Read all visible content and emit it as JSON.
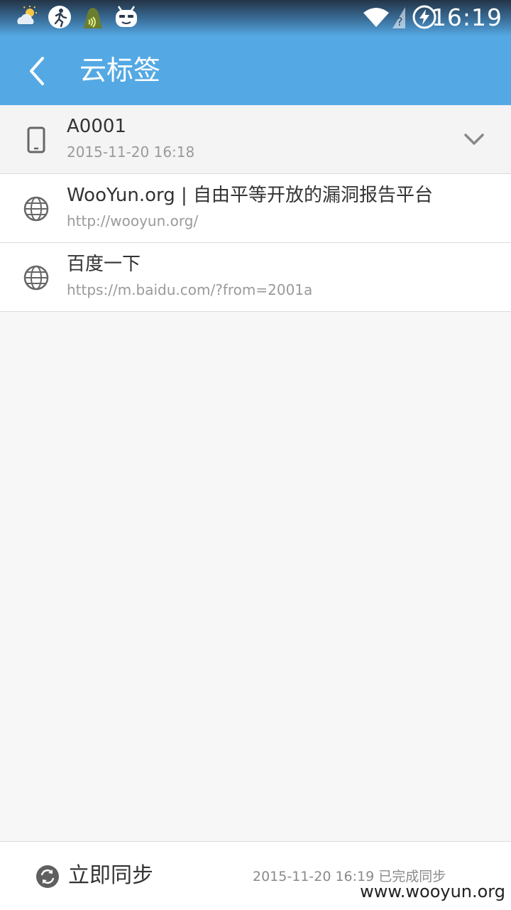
{
  "status_bar": {
    "time": "16:19",
    "left_icons": [
      "weather-icon",
      "fitness-icon",
      "notification-icon",
      "robot-icon"
    ],
    "right_icons": [
      "wifi-icon",
      "sim-unknown-icon",
      "battery-charging-icon"
    ]
  },
  "action_bar": {
    "title": "云标签"
  },
  "device": {
    "name": "A0001",
    "timestamp": "2015-11-20 16:18"
  },
  "bookmarks": [
    {
      "title": "WooYun.org | 自由平等开放的漏洞报告平台",
      "url": "http://wooyun.org/"
    },
    {
      "title": "百度一下",
      "url": "https://m.baidu.com/?from=2001a"
    }
  ],
  "bottom_bar": {
    "sync_label": "立即同步",
    "sync_status": "2015-11-20 16:19 已完成同步"
  },
  "watermark": "www.wooyun.org",
  "colors": {
    "action_bar": "#54a9e4",
    "background": "#f7f7f7",
    "text_primary": "#333333",
    "text_secondary": "#9a9a9a"
  }
}
